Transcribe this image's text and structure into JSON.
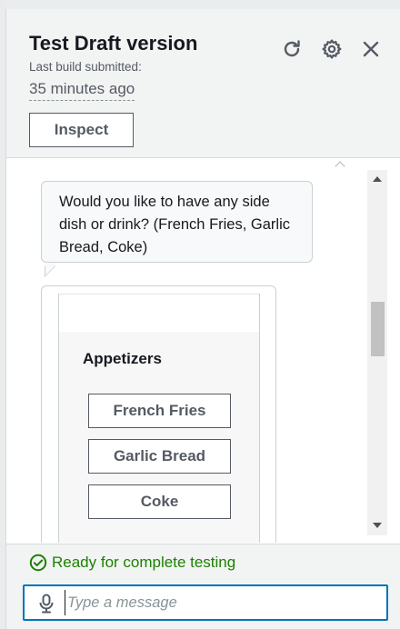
{
  "header": {
    "title": "Test Draft version",
    "subtitle": "Last build submitted:",
    "time_ago": "35 minutes ago",
    "inspect_label": "Inspect",
    "icons": [
      "refresh-icon",
      "settings-icon",
      "close-icon"
    ]
  },
  "chat": {
    "bot_message": "Would you like to have any side dish or drink? (French Fries, Garlic Bread, Coke)",
    "card": {
      "title": "Appetizers",
      "options": [
        "French Fries",
        "Garlic Bread",
        "Coke"
      ]
    }
  },
  "footer": {
    "status": "Ready for complete testing",
    "status_color": "#1d8102",
    "input_placeholder": "Type a message",
    "input_value": ""
  },
  "colors": {
    "accent": "#0073bb",
    "text": "#16191f",
    "muted": "#545b64"
  }
}
